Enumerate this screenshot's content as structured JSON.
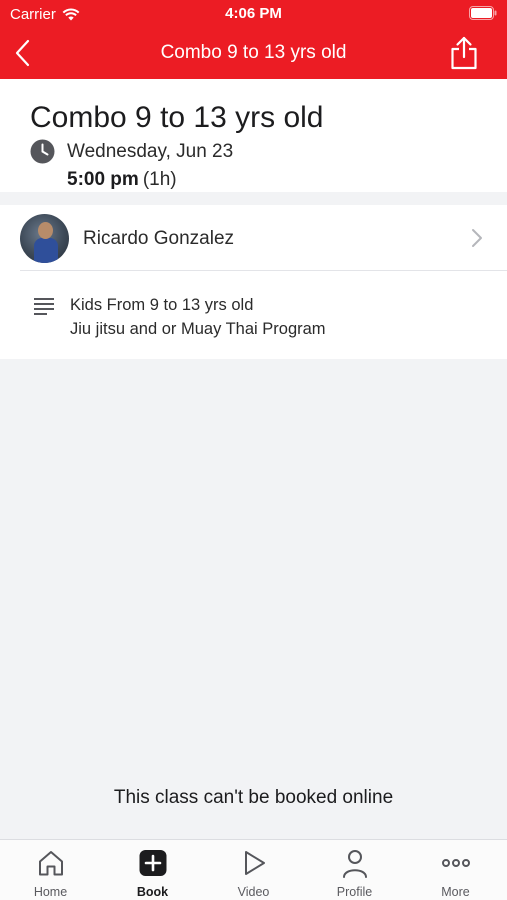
{
  "status_bar": {
    "carrier": "Carrier",
    "time": "4:06 PM"
  },
  "navbar": {
    "title": "Combo 9 to 13 yrs old",
    "icons": [
      "chevron-left-icon",
      "share-icon"
    ]
  },
  "class": {
    "title": "Combo 9 to 13 yrs old",
    "date": "Wednesday, Jun 23",
    "time": "5:00 pm",
    "duration": "(1h)"
  },
  "instructor": {
    "name": "Ricardo Gonzalez"
  },
  "description": {
    "line1": "Kids From 9 to 13 yrs old",
    "line2": "Jiu jitsu and or Muay Thai Program"
  },
  "booking_note": "This class can't be booked online",
  "tabbar": {
    "tabs": [
      {
        "label": "Home",
        "icon": "home-icon"
      },
      {
        "label": "Book",
        "icon": "plus-square-icon",
        "active": true
      },
      {
        "label": "Video",
        "icon": "play-icon"
      },
      {
        "label": "Profile",
        "icon": "person-icon"
      },
      {
        "label": "More",
        "icon": "ellipsis-icon"
      }
    ]
  },
  "colors": {
    "brand": "#ec1c24",
    "background": "#f2f3f5"
  }
}
